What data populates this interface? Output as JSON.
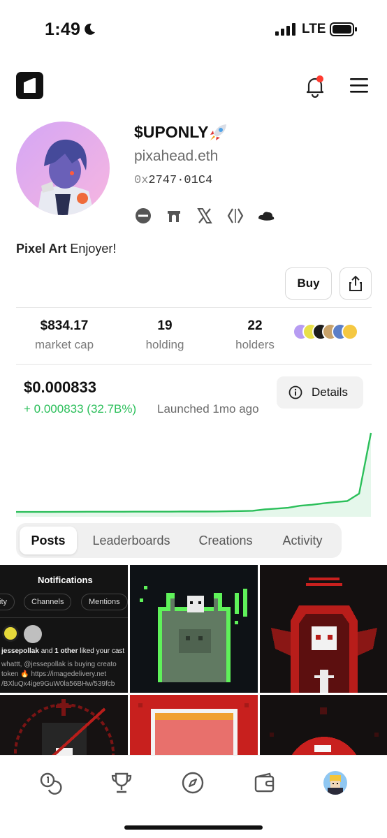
{
  "status_bar": {
    "time": "1:49",
    "network": "LTE",
    "icons": [
      "moon-icon",
      "cellular-signal-icon",
      "battery-icon"
    ]
  },
  "header": {
    "icons": [
      "app-logo-icon",
      "bell-icon",
      "hamburger-menu-icon"
    ],
    "notification_dot_color": "#ff3b30"
  },
  "profile": {
    "token_name": "$UPONLY",
    "token_emoji_icon": "rocket-icon",
    "ens_name": "pixahead.eth",
    "address_prefix": "0x",
    "address_rest": "2747·01C4",
    "social_icons": [
      "farcaster-circle-icon",
      "farcaster-arch-icon",
      "x-icon",
      "code-brackets-icon",
      "cloud-icon"
    ],
    "bio_bold": "Pixel Art",
    "bio_rest": " Enjoyer!"
  },
  "actions": {
    "buy_label": "Buy",
    "share_icon": "share-icon"
  },
  "stats": [
    {
      "value": "$834.17",
      "label": "market cap"
    },
    {
      "value": "19",
      "label": "holding"
    },
    {
      "value": "22",
      "label": "holders"
    }
  ],
  "price": {
    "value": "$0.000833",
    "change": "+ 0.000833 (32.7B%)",
    "launched": "Launched 1mo ago",
    "details_label": "Details",
    "accent_color": "#2bbf5a"
  },
  "chart_data": {
    "type": "area",
    "title": "",
    "xlabel": "",
    "ylabel": "",
    "grid": false,
    "series": [
      {
        "values": [
          2.1e-05,
          2.1e-05,
          2.1e-05,
          2.1e-05,
          2.2e-05,
          2.2e-05,
          2.3e-05,
          2.3e-05,
          2.3e-05,
          2.3e-05,
          2.4e-05,
          2.4e-05,
          2.4e-05,
          2.4e-05,
          2.5e-05,
          2.5e-05,
          2.5e-05,
          2.6e-05,
          2.8e-05,
          3e-05,
          3.3e-05,
          4.7e-05,
          5.5e-05,
          6.4e-05,
          8.5e-05,
          9.5e-05,
          0.00011,
          0.000123,
          0.000133,
          0.00021,
          0.000833
        ]
      }
    ],
    "color": "#2bbf5a"
  },
  "tabs": [
    {
      "label": "Posts",
      "active": true
    },
    {
      "label": "Leaderboards",
      "active": false
    },
    {
      "label": "Creations",
      "active": false
    },
    {
      "label": "Activity",
      "active": false
    }
  ],
  "posts": {
    "notification_card": {
      "title": "Notifications",
      "pills": [
        "ity",
        "Channels",
        "Mentions"
      ],
      "liker_bold": "jessepollak",
      "liker_mid": " and ",
      "liker_bold2": "1 other",
      "liker_rest": " liked your cast",
      "body_line1": "whattt, @jessepollak is buying creato",
      "body_line2": "token 🔥 https://imagedelivery.net",
      "body_line3": "/BXluQx4ige9GuW0la56BHw/539fcb"
    },
    "art_thumbnails": [
      "green-ghost-pixel-art",
      "red-skull-pixel-art",
      "dark-red-pixel-art",
      "red-frame-pixel-art",
      "red-orb-pixel-art"
    ]
  },
  "bottom_nav": {
    "icons": [
      "coins-icon",
      "trophy-icon",
      "compass-icon",
      "wallet-icon",
      "profile-avatar"
    ]
  }
}
